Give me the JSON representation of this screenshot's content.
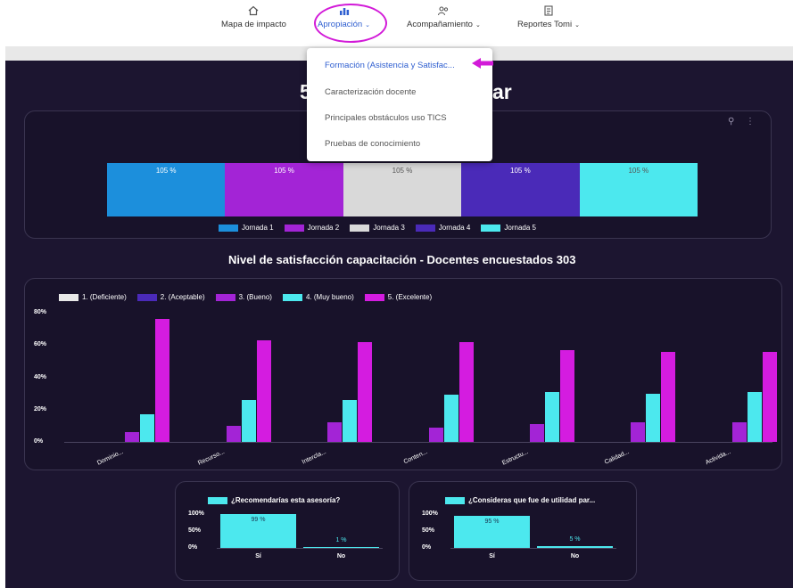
{
  "nav": {
    "items": [
      {
        "label": "Mapa de impacto",
        "icon": "home-icon",
        "caret": ""
      },
      {
        "label": "Apropiación",
        "icon": "bar-chart-icon",
        "caret": "⌄"
      },
      {
        "label": "Acompañamiento",
        "icon": "people-icon",
        "caret": "⌄"
      },
      {
        "label": "Reportes Tomi",
        "icon": "report-icon",
        "caret": "⌄"
      }
    ],
    "active": "Apropiación"
  },
  "dropdown": {
    "items": [
      "Formación (Asistencia y Satisfac...",
      "Caracterización docente",
      "Principales obstáculos uso TICS",
      "Pruebas de conocimiento"
    ],
    "active_index": 0
  },
  "dashboard": {
    "title_left": "5",
    "title_right": "ar",
    "attendance": {
      "segments": [
        {
          "label": "Jornada 1",
          "value": "105 %",
          "color": "#1c8fdc"
        },
        {
          "label": "Jornada 2",
          "value": "105 %",
          "color": "#a324d6"
        },
        {
          "label": "Jornada 3",
          "value": "105 %",
          "color": "#d9d9d9"
        },
        {
          "label": "Jornada 4",
          "value": "105 %",
          "color": "#4a2ab8"
        },
        {
          "label": "Jornada 5",
          "value": "105 %",
          "color": "#4ce8ee"
        }
      ]
    },
    "satisfaction_title": "Nivel de satisfacción capacitación - Docentes encuestados 303",
    "recomendarias": {
      "title": "¿Recomendarías esta asesoría?",
      "yticks": [
        "100%",
        "50%",
        "0%"
      ],
      "categories": [
        "Sí",
        "No"
      ],
      "labels": [
        "99 %",
        "1 %"
      ]
    },
    "utilidad": {
      "title": "¿Consideras que fue de utilidad par...",
      "yticks": [
        "100%",
        "50%",
        "0%"
      ],
      "categories": [
        "Sí",
        "No"
      ],
      "labels": [
        "95 %",
        "5 %"
      ]
    }
  },
  "chart_data": [
    {
      "type": "bar",
      "title": "",
      "categories": [
        "Jornada 1",
        "Jornada 2",
        "Jornada 3",
        "Jornada 4",
        "Jornada 5"
      ],
      "values": [
        105,
        105,
        105,
        105,
        105
      ],
      "legend": "bottom"
    },
    {
      "type": "bar",
      "title": "Nivel de satisfacción capacitación - Docentes encuestados 303",
      "categories": [
        "Dominio...",
        "Recurso...",
        "Intercla...",
        "Conten...",
        "Estructu...",
        "Calidad...",
        "Activida..."
      ],
      "ylim": [
        0,
        80
      ],
      "yticks": [
        "80%",
        "60%",
        "40%",
        "20%",
        "0%"
      ],
      "legend": "top",
      "series": [
        {
          "name": "1. (Deficiente)",
          "color": "#e8e8e8",
          "values": [
            0,
            0,
            0,
            0,
            0,
            0,
            0
          ]
        },
        {
          "name": "2. (Aceptable)",
          "color": "#4a2ab8",
          "values": [
            0,
            0,
            0,
            0,
            0,
            0,
            0
          ]
        },
        {
          "name": "3. (Bueno)",
          "color": "#a324d6",
          "values": [
            6,
            10,
            12,
            9,
            11,
            12,
            12
          ]
        },
        {
          "name": "4. (Muy bueno)",
          "color": "#4ce8ee",
          "values": [
            17,
            26,
            26,
            29,
            31,
            30,
            31
          ]
        },
        {
          "name": "5. (Excelente)",
          "color": "#d41ce0",
          "values": [
            76,
            63,
            62,
            62,
            57,
            56,
            56
          ]
        }
      ]
    },
    {
      "type": "bar",
      "title": "¿Recomendarías esta asesoría?",
      "categories": [
        "Sí",
        "No"
      ],
      "values": [
        99,
        1
      ],
      "ylim": [
        0,
        100
      ]
    },
    {
      "type": "bar",
      "title": "¿Consideras que fue de utilidad par...",
      "categories": [
        "Sí",
        "No"
      ],
      "values": [
        95,
        5
      ],
      "ylim": [
        0,
        100
      ]
    }
  ]
}
